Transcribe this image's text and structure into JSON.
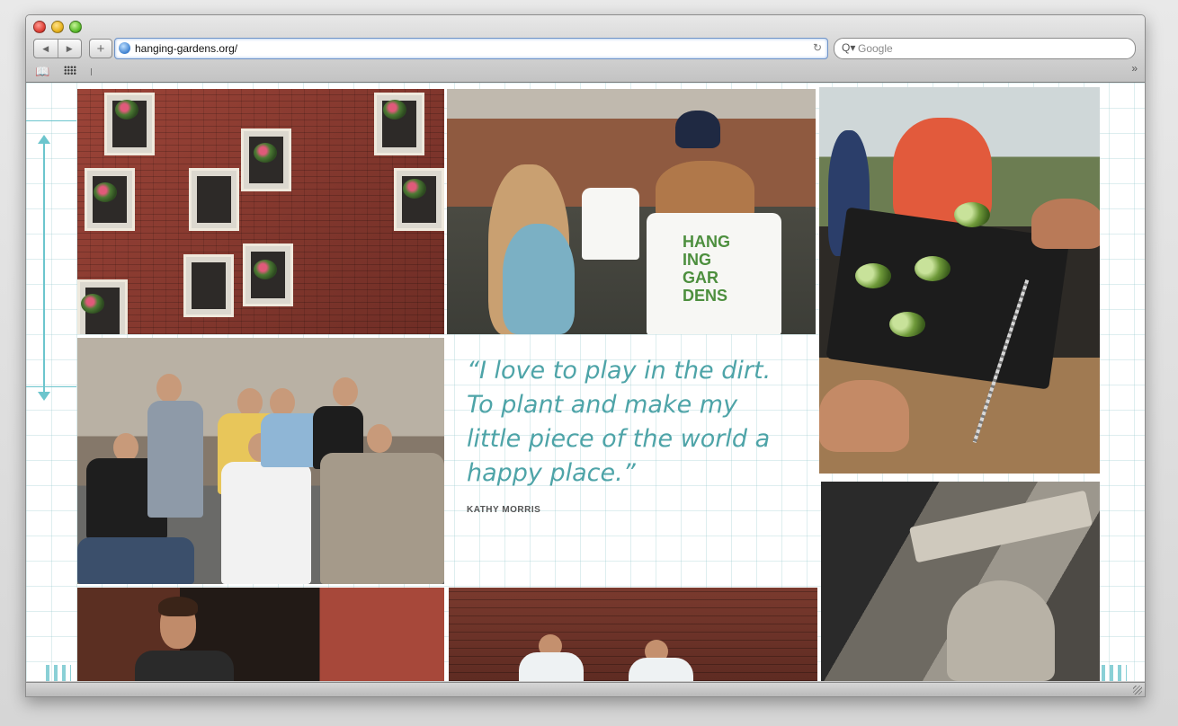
{
  "browser": {
    "url": "hanging-gardens.org/",
    "search_placeholder": "Google",
    "back_label": "◀",
    "forward_label": "▶",
    "new_tab_label": "+",
    "reload_label": "↻",
    "search_icon_label": "Q▾",
    "bookmarks_icon_label": "📖",
    "overflow_label": "»"
  },
  "photos": {
    "tshirt_print": "HANG\nING\nGAR\nDENS"
  },
  "quote": {
    "text": "“I love to play in the dirt. To plant and make my little piece of the world a happy place.”",
    "author": "KATHY MORRIS"
  },
  "colors": {
    "accent_teal": "#4ea4a8",
    "grid_line": "#a0cdd2"
  }
}
